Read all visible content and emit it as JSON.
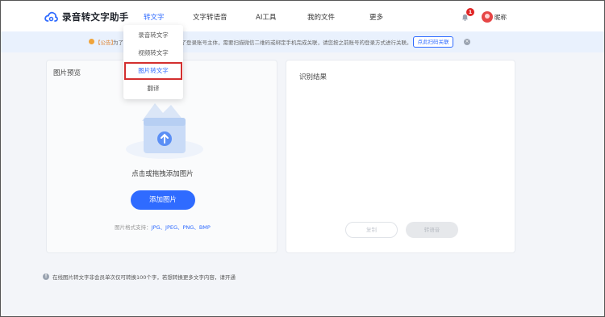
{
  "header": {
    "app_name": "录音转文字助手",
    "nav": [
      "转文字",
      "文字转语音",
      "AI工具",
      "我的文件",
      "更多"
    ],
    "notification_count": "1",
    "nickname": "昵称"
  },
  "notice": {
    "tag": "【公告】",
    "text": "为了您的账号安全，我们更新了登录账号主体，需要扫描微信二维码或绑定手机完成关联，请您按之前账号的登录方式进行关联。",
    "button": "点此扫码关联",
    "close_icon": "×"
  },
  "dropdown": {
    "items": [
      "录音转文字",
      "视频转文字",
      "图片转文字",
      "翻译"
    ]
  },
  "left_panel": {
    "title": "图片预览",
    "hint": "点击或拖拽添加图片",
    "button": "添加图片",
    "formats_label": "图片格式支持：",
    "formats_value": "JPG、JPEG、PNG、BMP"
  },
  "right_panel": {
    "title": "识别结果",
    "copy_button": "复制",
    "convert_button": "转语音"
  },
  "footer": {
    "icon": "!",
    "note": "在线图片转文字非会员单次仅可转换100个字，若想转换更多文字内容，请开通"
  },
  "colors": {
    "accent": "#2f6bff",
    "highlight_border": "#d32f2f",
    "badge": "#e02424"
  }
}
